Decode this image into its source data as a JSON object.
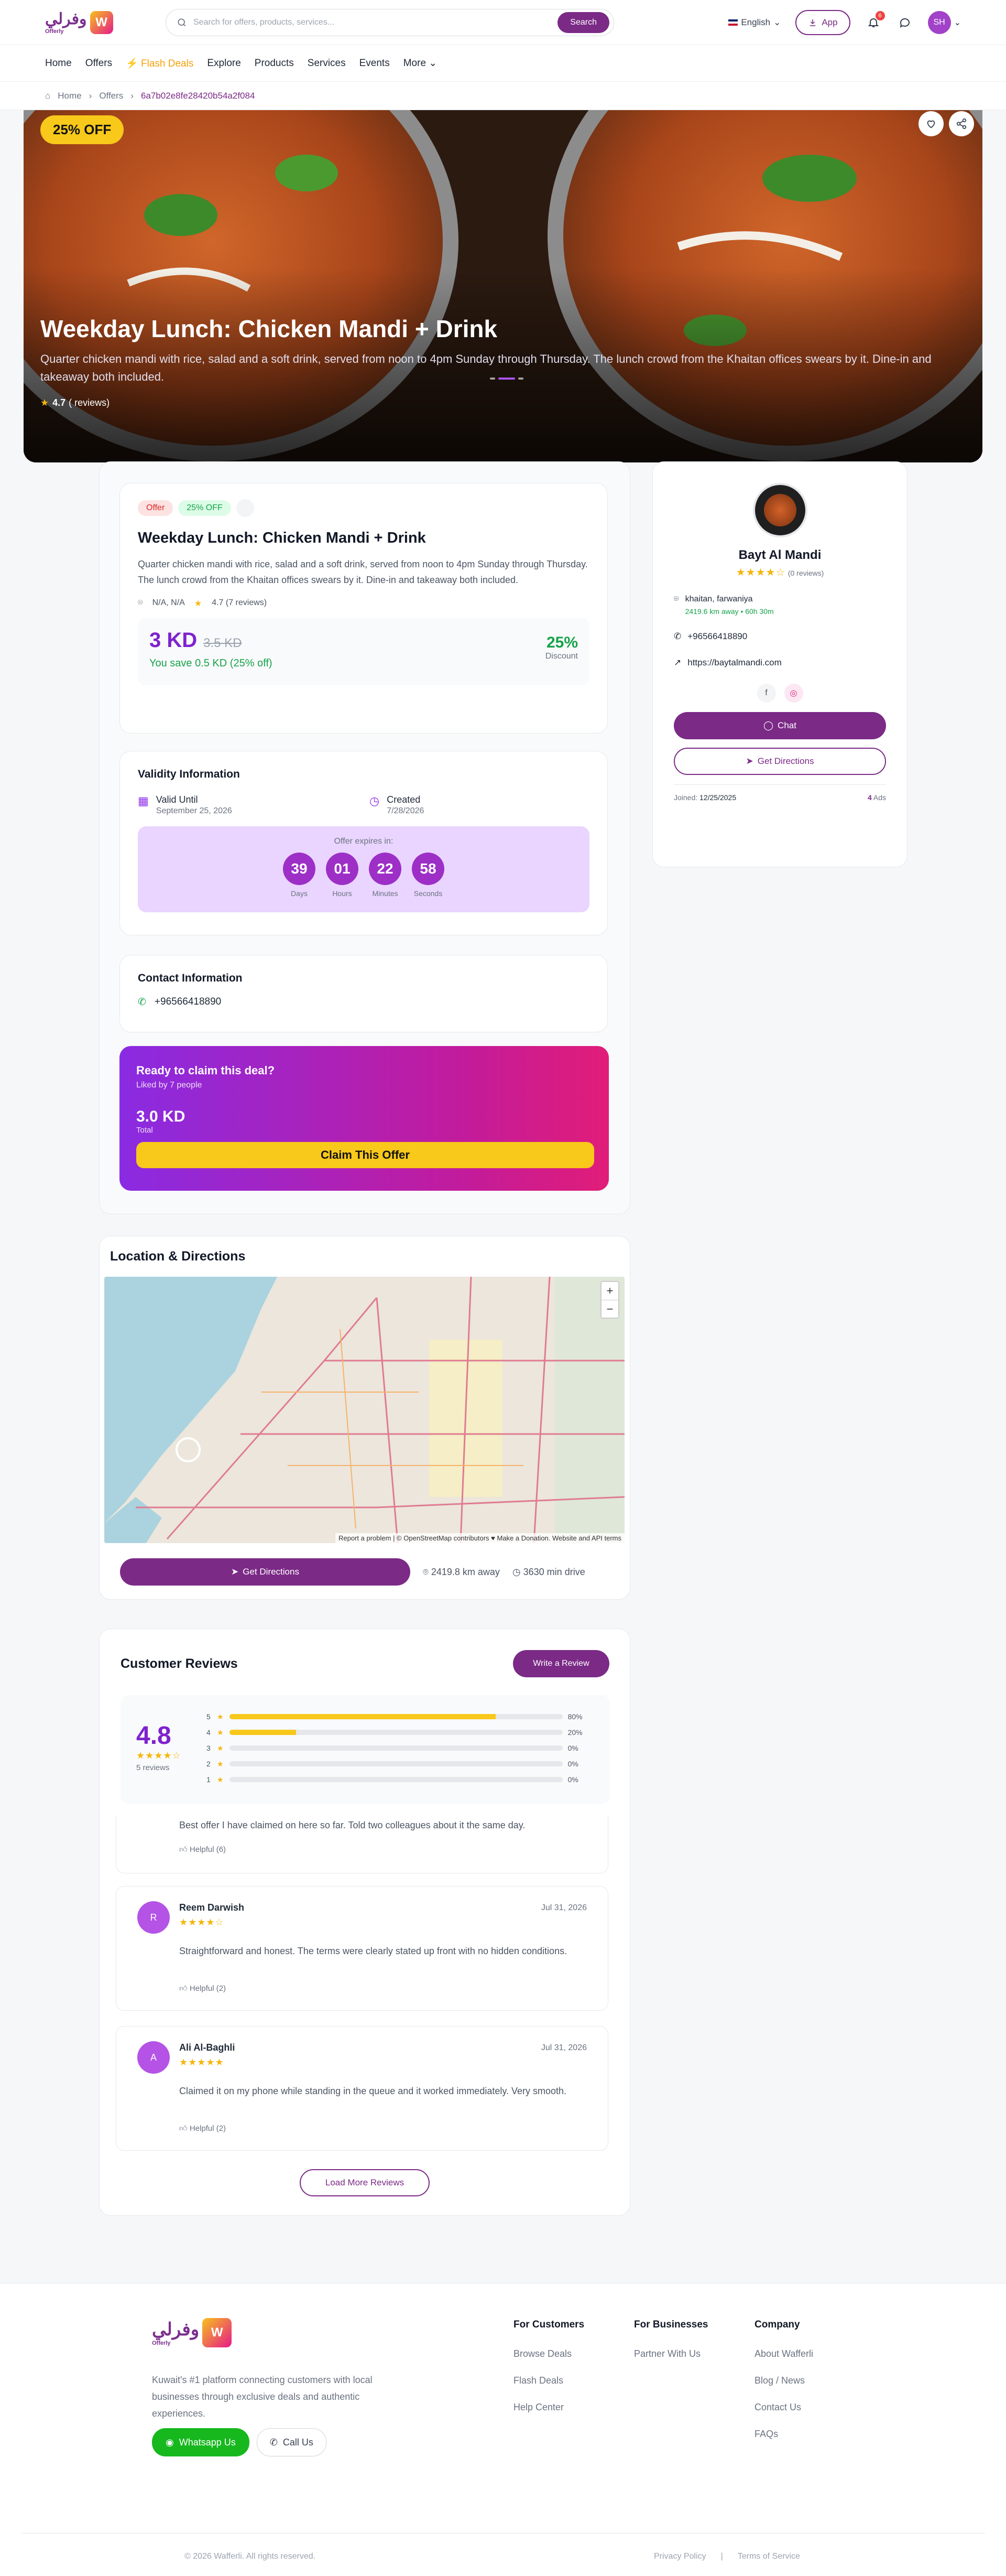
{
  "header": {
    "logo_ar": "وفرلي",
    "logo_en": "Offerly",
    "search_placeholder": "Search for offers, products, services...",
    "search_button": "Search",
    "language": "English",
    "app_button": "App",
    "notification_count": "6",
    "avatar_initials": "SH"
  },
  "nav": {
    "items": [
      "Home",
      "Offers",
      "Flash Deals",
      "Explore",
      "Products",
      "Services",
      "Events",
      "More"
    ]
  },
  "breadcrumb": {
    "home": "Home",
    "offers": "Offers",
    "current": "6a7b02e8fe28420b54a2f084"
  },
  "hero": {
    "discount_badge": "25% OFF",
    "title": "Weekday Lunch: Chicken Mandi + Drink",
    "description": "Quarter chicken mandi with rice, salad and a soft drink, served from noon to 4pm Sunday through Thursday. The lunch crowd from the Khaitan offices swears by it. Dine-in and takeaway both included.",
    "rating": "4.7",
    "rating_reviews": "( reviews)"
  },
  "offer": {
    "tag_type": "Offer",
    "tag_discount": "25% OFF",
    "title": "Weekday Lunch: Chicken Mandi + Drink",
    "description": "Quarter chicken mandi with rice, salad and a soft drink, served from noon to 4pm Sunday through Thursday. The lunch crowd from the Khaitan offices swears by it. Dine-in and takeaway both included.",
    "location": "N/A, N/A",
    "rating": "4.7 (7 reviews)",
    "price": "3 KD",
    "old_price": "3.5 KD",
    "savings": "You save 0.5 KD (25% off)",
    "discount_value": "25%",
    "discount_label": "Discount"
  },
  "validity": {
    "title": "Validity Information",
    "valid_label": "Valid Until",
    "valid_date": "September 25, 2026",
    "created_label": "Created",
    "created_date": "7/28/2026",
    "expires_label": "Offer expires in:",
    "countdown": [
      {
        "value": "39",
        "label": "Days"
      },
      {
        "value": "01",
        "label": "Hours"
      },
      {
        "value": "22",
        "label": "Minutes"
      },
      {
        "value": "58",
        "label": "Seconds"
      }
    ]
  },
  "contact": {
    "title": "Contact Information",
    "phone": "+96566418890"
  },
  "claim": {
    "title": "Ready to claim this deal?",
    "liked": "Liked by 7 people",
    "total": "3.0 KD",
    "total_label": "Total",
    "button": "Claim This Offer"
  },
  "business": {
    "name": "Bayt Al Mandi",
    "reviews": "(0 reviews)",
    "address": "khaitan, farwaniya",
    "distance": "2419.6 km away • 60h 30m",
    "phone": "+96566418890",
    "website": "https://baytalmandi.com",
    "chat_button": "Chat",
    "directions_button": "Get Directions",
    "joined_label": "Joined:",
    "joined_date": "12/25/2025",
    "ads_count": "4",
    "ads_label": "Ads"
  },
  "location": {
    "title": "Location & Directions",
    "attribution": "Report a problem | © OpenStreetMap contributors ♥ Make a Donation. Website and API terms",
    "directions_button": "Get Directions",
    "distance": "2419.8 km away",
    "drive": "3630 min drive"
  },
  "reviews": {
    "title": "Customer Reviews",
    "write_button": "Write a Review",
    "average": "4.8",
    "count": "5 reviews",
    "distribution": [
      {
        "star": "5",
        "percent": 80,
        "label": "80%"
      },
      {
        "star": "4",
        "percent": 20,
        "label": "20%"
      },
      {
        "star": "3",
        "percent": 0,
        "label": "0%"
      },
      {
        "star": "2",
        "percent": 0,
        "label": "0%"
      },
      {
        "star": "1",
        "percent": 0,
        "label": "0%"
      }
    ],
    "partial_text": "Best offer I have claimed on here so far. Told two colleagues about it the same day.",
    "partial_helpful": "Helpful (6)",
    "items": [
      {
        "initial": "R",
        "name": "Reem Darwish",
        "date": "Jul 31, 2026",
        "stars": "★★★★☆",
        "text": "Straightforward and honest. The terms were clearly stated up front with no hidden conditions.",
        "helpful": "Helpful (2)"
      },
      {
        "initial": "A",
        "name": "Ali Al-Baghli",
        "date": "Jul 31, 2026",
        "stars": "★★★★★",
        "text": "Claimed it on my phone while standing in the queue and it worked immediately. Very smooth.",
        "helpful": "Helpful (2)"
      }
    ],
    "load_more": "Load More Reviews"
  },
  "footer": {
    "tagline": "Kuwait's #1 platform connecting customers with local businesses through exclusive deals and authentic experiences.",
    "whatsapp": "Whatsapp Us",
    "call": "Call Us",
    "customers_title": "For Customers",
    "customers_links": [
      "Browse Deals",
      "Flash Deals",
      "Help Center"
    ],
    "business_title": "For Businesses",
    "business_links": [
      "Partner With Us"
    ],
    "company_title": "Company",
    "company_links": [
      "About Wafferli",
      "Blog / News",
      "Contact Us",
      "FAQs"
    ],
    "copyright": "© 2026 Wafferli. All rights reserved.",
    "privacy": "Privacy Policy",
    "terms": "Terms of Service"
  },
  "colors": {
    "brand": "#7b2a86",
    "accent_yellow": "#f8c81a",
    "success": "#16a34a"
  }
}
